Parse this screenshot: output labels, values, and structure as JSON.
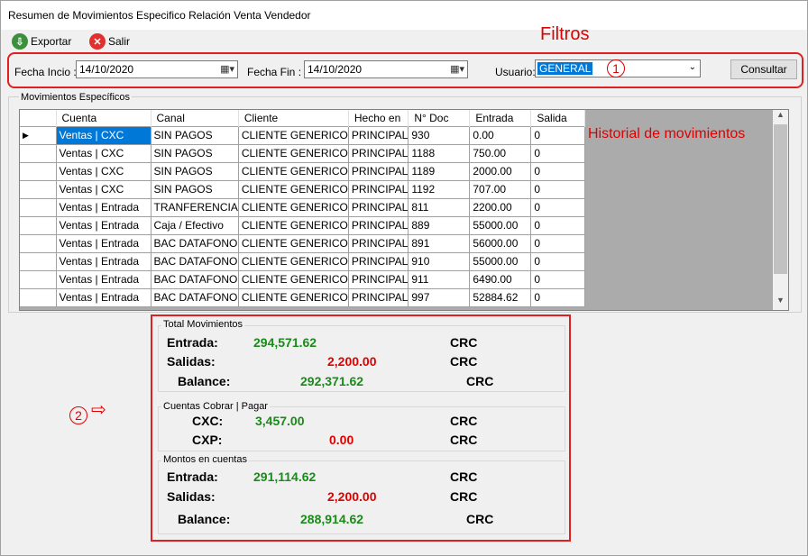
{
  "window": {
    "title": "Resumen de Movimientos Especifico Relación Venta Vendedor"
  },
  "toolbar": {
    "export_label": "Exportar",
    "exit_label": "Salir"
  },
  "annotations": {
    "filters": "Filtros",
    "history": "Historial de movimientos",
    "num1": "1",
    "num2": "2"
  },
  "filters": {
    "start_label": "Fecha Incio :",
    "start_value": "14/10/2020",
    "end_label": "Fecha Fin :",
    "end_value": "14/10/2020",
    "user_label": "Usuario:",
    "user_value": "GENERAL",
    "query_button": "Consultar"
  },
  "movements": {
    "group_title": "Movimientos Específicos",
    "columns": [
      "Cuenta",
      "Canal",
      "Cliente",
      "Hecho en",
      "N° Doc",
      "Entrada",
      "Salida"
    ],
    "rows": [
      [
        "Ventas | CXC",
        "SIN PAGOS",
        "CLIENTE GENERICO",
        "PRINCIPAL",
        "930",
        "0.00",
        "0"
      ],
      [
        "Ventas | CXC",
        "SIN PAGOS",
        "CLIENTE GENERICO",
        "PRINCIPAL",
        "1188",
        "750.00",
        "0"
      ],
      [
        "Ventas | CXC",
        "SIN PAGOS",
        "CLIENTE GENERICO",
        "PRINCIPAL",
        "1189",
        "2000.00",
        "0"
      ],
      [
        "Ventas | CXC",
        "SIN PAGOS",
        "CLIENTE GENERICO",
        "PRINCIPAL",
        "1192",
        "707.00",
        "0"
      ],
      [
        "Ventas | Entrada",
        "TRANFERENCIA",
        "CLIENTE GENERICO",
        "PRINCIPAL",
        "811",
        "2200.00",
        "0"
      ],
      [
        "Ventas | Entrada",
        "Caja / Efectivo",
        "CLIENTE GENERICO",
        "PRINCIPAL",
        "889",
        "55000.00",
        "0"
      ],
      [
        "Ventas | Entrada",
        "BAC DATAFONO",
        "CLIENTE GENERICO",
        "PRINCIPAL",
        "891",
        "56000.00",
        "0"
      ],
      [
        "Ventas | Entrada",
        "BAC DATAFONO",
        "CLIENTE GENERICO",
        "PRINCIPAL",
        "910",
        "55000.00",
        "0"
      ],
      [
        "Ventas | Entrada",
        "BAC DATAFONO",
        "CLIENTE GENERICO",
        "PRINCIPAL",
        "911",
        "6490.00",
        "0"
      ],
      [
        "Ventas | Entrada",
        "BAC DATAFONO",
        "CLIENTE GENERICO",
        "PRINCIPAL",
        "997",
        "52884.62",
        "0"
      ]
    ]
  },
  "totals": {
    "title": "Total Movimientos",
    "entrada_label": "Entrada:",
    "entrada_value": "294,571.62",
    "entrada_cur": "CRC",
    "salidas_label": "Salidas:",
    "salidas_value": "2,200.00",
    "salidas_cur": "CRC",
    "balance_label": "Balance:",
    "balance_value": "292,371.62",
    "balance_cur": "CRC"
  },
  "accounts": {
    "title": "Cuentas Cobrar | Pagar",
    "cxc_label": "CXC:",
    "cxc_value": "3,457.00",
    "cxc_cur": "CRC",
    "cxp_label": "CXP:",
    "cxp_value": "0.00",
    "cxp_cur": "CRC"
  },
  "amounts": {
    "title": "Montos en cuentas",
    "entrada_label": "Entrada:",
    "entrada_value": "291,114.62",
    "entrada_cur": "CRC",
    "salidas_label": "Salidas:",
    "salidas_value": "2,200.00",
    "salidas_cur": "CRC",
    "balance_label": "Balance:",
    "balance_value": "288,914.62",
    "balance_cur": "CRC"
  }
}
